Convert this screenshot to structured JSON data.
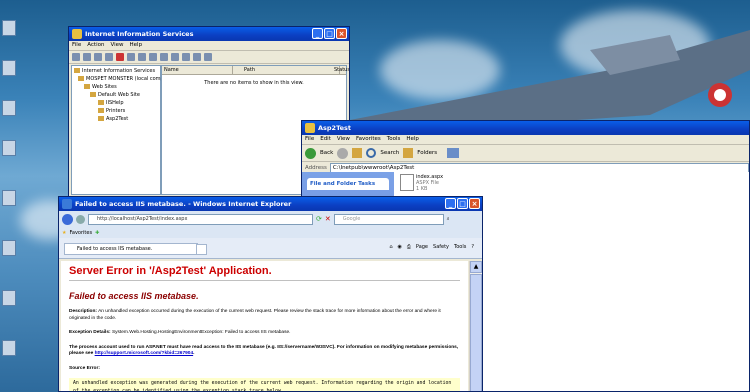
{
  "iis": {
    "title": "Internet Information Services",
    "menu": [
      "File",
      "Action",
      "View",
      "Help"
    ],
    "tree": [
      "Internet Information Services",
      "MOSPET MONSTER (local compu",
      "Web Sites",
      "Default Web Site",
      "IISHelp",
      "Printers",
      "Asp2Test"
    ],
    "columns": [
      "Name",
      "Path",
      "Status"
    ],
    "empty_message": "There are no items to show in this view."
  },
  "explorer": {
    "title": "Asp2Test",
    "menu": [
      "File",
      "Edit",
      "View",
      "Favorites",
      "Tools",
      "Help"
    ],
    "back_label": "Back",
    "search_label": "Search",
    "folders_label": "Folders",
    "address_label": "Address",
    "address_value": "C:\\Inetpub\\wwwroot\\Asp2Test",
    "tasks_label": "File and Folder Tasks",
    "file_name": "index.aspx",
    "file_type": "ASPX File",
    "file_size": "1 KB"
  },
  "ie": {
    "title": "Failed to access IIS metabase. - Windows Internet Explorer",
    "address": "http://localhost/Asp2Test/index.aspx",
    "search_placeholder": "Google",
    "favorites_label": "Favorites",
    "tab_label": "Failed to access IIS metabase.",
    "page_label": "Page",
    "safety_label": "Safety",
    "tools_label": "Tools"
  },
  "error": {
    "heading": "Server Error in '/Asp2Test' Application.",
    "subheading": "Failed to access IIS metabase.",
    "desc_label": "Description:",
    "desc_text": "An unhandled exception occurred during the execution of the current web request. Please review the stack trace for more information about the error and where it originated in the code.",
    "exc_label": "Exception Details:",
    "exc_text": "System.Web.Hosting.HostingEnvironmentException: Failed to access IIS metabase.",
    "bold_para_pre": "The process account used to run ASP.NET must have read access to the IIS metabase (e.g. IIS://servername/W3SVC). For information on modifying metabase permissions, please see",
    "bold_link": "http://support.microsoft.com/?kbid=267904",
    "source_label": "Source Error:",
    "code_text": "An unhandled exception was generated during the execution of the current web request. Information regarding the origin and location of the exception can be identified using the exception stack trace below."
  }
}
